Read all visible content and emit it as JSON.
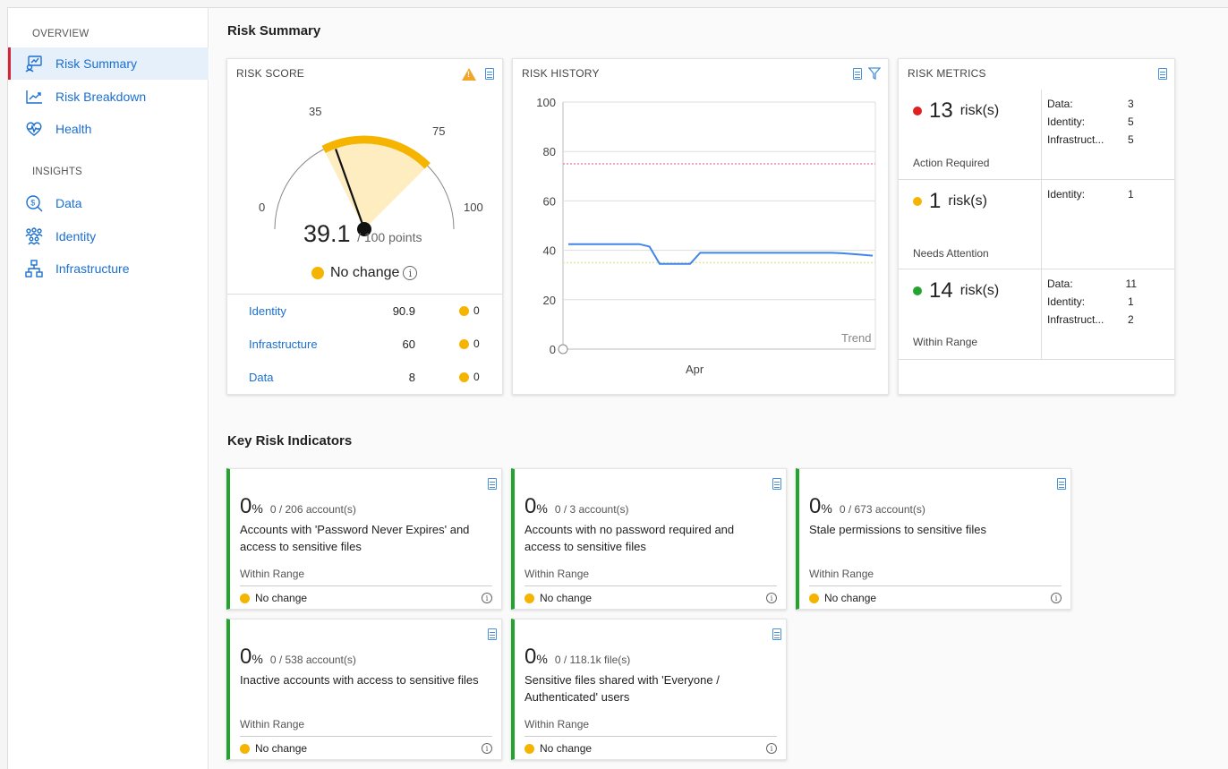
{
  "sidebar": {
    "overview_heading": "OVERVIEW",
    "insights_heading": "INSIGHTS",
    "overview_items": [
      {
        "label": "Risk Summary",
        "icon": "risk-summary-icon",
        "active": true
      },
      {
        "label": "Risk Breakdown",
        "icon": "trend-chart-icon"
      },
      {
        "label": "Health",
        "icon": "heart-pulse-icon"
      }
    ],
    "insights_items": [
      {
        "label": "Data",
        "icon": "data-search-icon"
      },
      {
        "label": "Identity",
        "icon": "users-group-icon"
      },
      {
        "label": "Infrastructure",
        "icon": "network-hierarchy-icon"
      }
    ]
  },
  "page_title": "Risk Summary",
  "risk_score": {
    "title": "RISK SCORE",
    "gauge": {
      "min": 0,
      "max": 100,
      "range_low": 35,
      "range_high": 75,
      "value": 39.1
    },
    "labels": {
      "min": "0",
      "max": "100",
      "low": "35",
      "high": "75"
    },
    "score": "39.1",
    "score_suffix": "/ 100 points",
    "change_text": "No change",
    "rows": [
      {
        "name": "Identity",
        "value": "90.9",
        "change": "0"
      },
      {
        "name": "Infrastructure",
        "value": "60",
        "change": "0"
      },
      {
        "name": "Data",
        "value": "8",
        "change": "0"
      }
    ]
  },
  "risk_history": {
    "title": "RISK HISTORY",
    "trend_label": "Trend",
    "x_label": "Apr"
  },
  "chart_data": {
    "type": "line",
    "ylim": [
      0,
      100
    ],
    "yticks": [
      "0",
      "20",
      "40",
      "60",
      "80",
      "100"
    ],
    "x_tick_labels": [
      "Apr"
    ],
    "upper_threshold": 75,
    "lower_threshold": 35,
    "series": [
      {
        "values": [
          42.5,
          42.5,
          42.5,
          42.5,
          42.5,
          42.5,
          42.5,
          42.5,
          41.5,
          34.5,
          34.5,
          34.5,
          34.5,
          39,
          39,
          39,
          39,
          39,
          39,
          39,
          39,
          39,
          39,
          39,
          39,
          39,
          39,
          38.8,
          38.5,
          38.2,
          37.8
        ]
      }
    ]
  },
  "risk_metrics": {
    "title": "RISK METRICS",
    "rows": [
      {
        "count": "13",
        "unit": "risk(s)",
        "status": "Action Required",
        "color": "#e02020",
        "details": [
          {
            "k": "Data:",
            "v": "3"
          },
          {
            "k": "Identity:",
            "v": "5"
          },
          {
            "k": "Infrastruct...",
            "v": "5"
          }
        ]
      },
      {
        "count": "1",
        "unit": "risk(s)",
        "status": "Needs Attention",
        "color": "#f5b400",
        "details": [
          {
            "k": "Identity:",
            "v": "1"
          }
        ]
      },
      {
        "count": "14",
        "unit": "risk(s)",
        "status": "Within Range",
        "color": "#25a32f",
        "details": [
          {
            "k": "Data:",
            "v": "11"
          },
          {
            "k": "Identity:",
            "v": "1"
          },
          {
            "k": "Infrastruct...",
            "v": "2"
          }
        ]
      }
    ]
  },
  "kri_title": "Key Risk Indicators",
  "kris": [
    {
      "pct": "0",
      "ratio": "0 / 206 account(s)",
      "desc": "Accounts with 'Password Never Expires' and access to sensitive files",
      "range": "Within Range",
      "change": "No change"
    },
    {
      "pct": "0",
      "ratio": "0 / 3 account(s)",
      "desc": "Accounts with no password required and access to sensitive files",
      "range": "Within Range",
      "change": "No change"
    },
    {
      "pct": "0",
      "ratio": "0 / 673 account(s)",
      "desc": "Stale permissions to sensitive files",
      "range": "Within Range",
      "change": "No change"
    },
    {
      "pct": "0",
      "ratio": "0 / 538 account(s)",
      "desc": "Inactive accounts with access to sensitive files",
      "range": "Within Range",
      "change": "No change"
    },
    {
      "pct": "0",
      "ratio": "0 / 118.1k file(s)",
      "desc": "Sensitive files shared with 'Everyone / Authenticated' users",
      "range": "Within Range",
      "change": "No change"
    }
  ],
  "pct_symbol": "%",
  "info_glyph": "i",
  "colors": {
    "accent": "#1a6fd1",
    "gauge": "#f5b400",
    "gauge_fill": "#fdedc0",
    "good": "#25a32f",
    "bad": "#e02020",
    "warn": "#f5b400"
  }
}
